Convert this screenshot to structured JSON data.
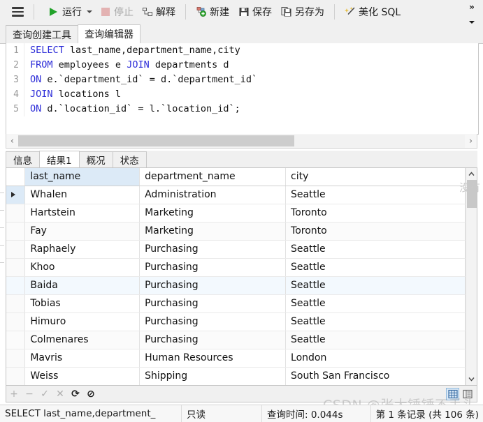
{
  "toolbar": {
    "menu_icon": "hamburger-icon",
    "buttons": [
      {
        "id": "run",
        "label": "运行",
        "icon": "play-icon",
        "enabled": true,
        "has_caret": true
      },
      {
        "id": "stop",
        "label": "停止",
        "icon": "stop-icon",
        "enabled": false,
        "has_caret": false
      },
      {
        "id": "explain",
        "label": "解释",
        "icon": "explain-icon",
        "enabled": true,
        "has_caret": false
      },
      {
        "id": "new",
        "label": "新建",
        "icon": "new-file-icon",
        "enabled": true,
        "has_caret": false
      },
      {
        "id": "save",
        "label": "保存",
        "icon": "save-icon",
        "enabled": true,
        "has_caret": false
      },
      {
        "id": "saveas",
        "label": "另存为",
        "icon": "save-as-icon",
        "enabled": true,
        "has_caret": false
      },
      {
        "id": "beautify",
        "label": "美化 SQL",
        "icon": "magic-wand-icon",
        "enabled": true,
        "has_caret": false
      }
    ],
    "overflow_label": "»"
  },
  "top_tabs": [
    {
      "label": "查询创建工具",
      "active": false
    },
    {
      "label": "查询编辑器",
      "active": true
    }
  ],
  "editor": {
    "lines": [
      {
        "num": "1",
        "tokens": [
          {
            "t": "SELECT",
            "kw": true
          },
          {
            "t": " last_name,department_name,city",
            "kw": false
          }
        ]
      },
      {
        "num": "2",
        "tokens": [
          {
            "t": "FROM",
            "kw": true
          },
          {
            "t": " employees e ",
            "kw": false
          },
          {
            "t": "JOIN",
            "kw": true
          },
          {
            "t": " departments d",
            "kw": false
          }
        ]
      },
      {
        "num": "3",
        "tokens": [
          {
            "t": "ON",
            "kw": true
          },
          {
            "t": " e.`department_id` = d.`department_id`",
            "kw": false
          }
        ]
      },
      {
        "num": "4",
        "tokens": [
          {
            "t": "JOIN",
            "kw": true
          },
          {
            "t": " locations l",
            "kw": false
          }
        ]
      },
      {
        "num": "5",
        "tokens": [
          {
            "t": "ON",
            "kw": true
          },
          {
            "t": " d.`location_id` = l.`location_id`;",
            "kw": false
          }
        ]
      }
    ],
    "hscroll": {
      "left_arrow": "‹",
      "right_arrow": "›"
    }
  },
  "result_tabs": [
    {
      "label": "信息",
      "active": false
    },
    {
      "label": "结果1",
      "active": true
    },
    {
      "label": "概况",
      "active": false
    },
    {
      "label": "状态",
      "active": false
    }
  ],
  "grid": {
    "columns": [
      "last_name",
      "department_name",
      "city"
    ],
    "selected_column": "last_name",
    "current_row_index": 0,
    "rows": [
      [
        "Whalen",
        "Administration",
        "Seattle"
      ],
      [
        "Hartstein",
        "Marketing",
        "Toronto"
      ],
      [
        "Fay",
        "Marketing",
        "Toronto"
      ],
      [
        "Raphaely",
        "Purchasing",
        "Seattle"
      ],
      [
        "Khoo",
        "Purchasing",
        "Seattle"
      ],
      [
        "Baida",
        "Purchasing",
        "Seattle"
      ],
      [
        "Tobias",
        "Purchasing",
        "Seattle"
      ],
      [
        "Himuro",
        "Purchasing",
        "Seattle"
      ],
      [
        "Colmenares",
        "Purchasing",
        "Seattle"
      ],
      [
        "Mavris",
        "Human Resources",
        "London"
      ],
      [
        "Weiss",
        "Shipping",
        "South San Francisco"
      ]
    ],
    "tinted_rows": [
      5
    ],
    "zebra_rows": [
      2,
      8
    ],
    "vscroll": {
      "up": "⌃",
      "down": "⌄"
    }
  },
  "grid_toolbar": {
    "buttons": [
      {
        "id": "add",
        "glyph": "+",
        "icon": "plus-icon",
        "enabled": false
      },
      {
        "id": "remove",
        "glyph": "−",
        "icon": "minus-icon",
        "enabled": false
      },
      {
        "id": "confirm",
        "glyph": "✓",
        "icon": "check-icon",
        "enabled": false
      },
      {
        "id": "cancel",
        "glyph": "✕",
        "icon": "cross-icon",
        "enabled": false
      },
      {
        "id": "refresh",
        "glyph": "⟳",
        "icon": "refresh-icon",
        "enabled": true
      },
      {
        "id": "stop",
        "glyph": "⊘",
        "icon": "ban-icon",
        "enabled": true
      }
    ],
    "view_modes": [
      {
        "id": "grid-view",
        "icon": "grid-view-icon",
        "selected": true
      },
      {
        "id": "form-view",
        "icon": "form-view-icon",
        "selected": false
      }
    ]
  },
  "side_panel": {
    "placeholder": "没有"
  },
  "status_bar": {
    "query": "SELECT last_name,department_",
    "readonly": "只读",
    "query_time": "查询时间: 0.044s",
    "record_info": "第 1 条记录 (共 106 条)"
  },
  "watermark": {
    "text": "CSDN @张大锤锤不丢头"
  },
  "colors": {
    "accent_blue": "#dceaf7",
    "keyword_blue": "#2c2cd8",
    "run_green": "#22a22a",
    "toolbar_bg": "#f0f0f0"
  }
}
